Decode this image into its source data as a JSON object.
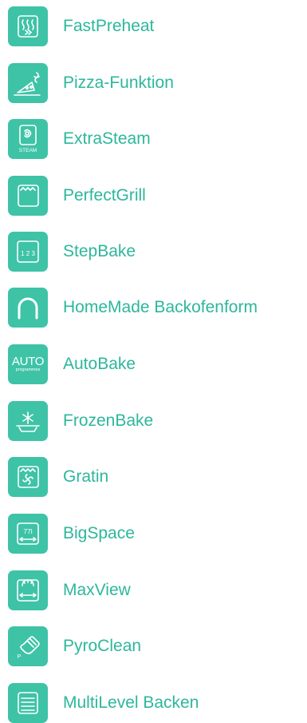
{
  "features": [
    {
      "label": "FastPreheat",
      "icon": "fast-preheat-icon"
    },
    {
      "label": "Pizza-Funktion",
      "icon": "pizza-icon"
    },
    {
      "label": "ExtraSteam",
      "icon": "steam-icon",
      "badge": "STEAM"
    },
    {
      "label": "PerfectGrill",
      "icon": "grill-icon"
    },
    {
      "label": "StepBake",
      "icon": "step-bake-icon",
      "badge": "1 2 3"
    },
    {
      "label": "HomeMade Backofenform",
      "icon": "homemade-oven-shape-icon"
    },
    {
      "label": "AutoBake",
      "icon": "auto-programmes-icon",
      "badge": "AUTO",
      "badge_sub": "programmes"
    },
    {
      "label": "FrozenBake",
      "icon": "frozen-bake-icon"
    },
    {
      "label": "Gratin",
      "icon": "gratin-icon"
    },
    {
      "label": "BigSpace",
      "icon": "big-space-icon",
      "badge": "77l"
    },
    {
      "label": "MaxView",
      "icon": "max-view-icon"
    },
    {
      "label": "PyroClean",
      "icon": "pyro-clean-icon",
      "badge": "P"
    },
    {
      "label": "MultiLevel Backen",
      "icon": "multilevel-icon"
    }
  ],
  "colors": {
    "tile": "#3ec3a7",
    "label": "#2db79c",
    "icon_line": "#ffffff"
  }
}
